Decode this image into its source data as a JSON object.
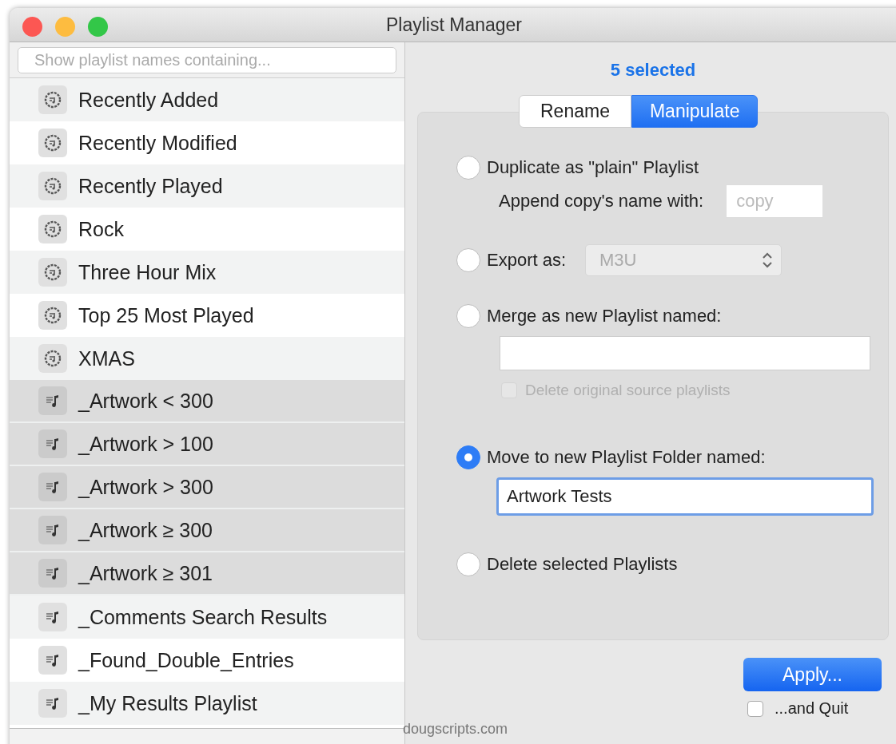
{
  "window": {
    "title": "Playlist Manager"
  },
  "search": {
    "placeholder": "Show playlist names containing..."
  },
  "playlists": [
    {
      "name": "Recently Added",
      "kind": "smart",
      "selected": false
    },
    {
      "name": "Recently Modified",
      "kind": "smart",
      "selected": false
    },
    {
      "name": "Recently Played",
      "kind": "smart",
      "selected": false
    },
    {
      "name": "Rock",
      "kind": "smart",
      "selected": false
    },
    {
      "name": "Three Hour Mix",
      "kind": "smart",
      "selected": false
    },
    {
      "name": "Top 25 Most Played",
      "kind": "smart",
      "selected": false
    },
    {
      "name": "XMAS",
      "kind": "smart",
      "selected": false
    },
    {
      "name": "_Artwork < 300",
      "kind": "plain",
      "selected": true
    },
    {
      "name": "_Artwork > 100",
      "kind": "plain",
      "selected": true
    },
    {
      "name": "_Artwork > 300",
      "kind": "plain",
      "selected": true
    },
    {
      "name": "_Artwork ≥ 300",
      "kind": "plain",
      "selected": true
    },
    {
      "name": "_Artwork ≥ 301",
      "kind": "plain",
      "selected": true
    },
    {
      "name": "_Comments Search Results",
      "kind": "plain",
      "selected": false
    },
    {
      "name": "_Found_Double_Entries",
      "kind": "plain",
      "selected": false
    },
    {
      "name": "_My Results Playlist",
      "kind": "plain",
      "selected": false
    }
  ],
  "selection_count": "5 selected",
  "tabs": [
    {
      "label": "Rename",
      "selected": false
    },
    {
      "label": "Manipulate",
      "selected": true
    }
  ],
  "options": [
    {
      "kind": "duplicate",
      "label": "Duplicate as \"plain\" Playlist",
      "selected": false,
      "sub_label": "Append copy's name with:",
      "field": {
        "placeholder": "copy"
      }
    },
    {
      "kind": "export",
      "label": "Export as:",
      "selected": false,
      "popup": {
        "value": "M3U",
        "disabled": true
      }
    },
    {
      "kind": "merge",
      "label": "Merge as new Playlist named:",
      "selected": false,
      "field": {
        "focused": false
      },
      "checkbox": {
        "label": "Delete original source playlists",
        "checked": false,
        "disabled": true
      }
    },
    {
      "kind": "move",
      "label": "Move to new Playlist Folder named:",
      "selected": true,
      "field": {
        "value": "Artwork Tests",
        "focused": true
      }
    },
    {
      "kind": "delete",
      "label": "Delete selected Playlists",
      "selected": false
    }
  ],
  "apply_button": "Apply...",
  "quit_checkbox": {
    "label": "...and Quit",
    "checked": false
  },
  "footer": "dougscripts.com"
}
